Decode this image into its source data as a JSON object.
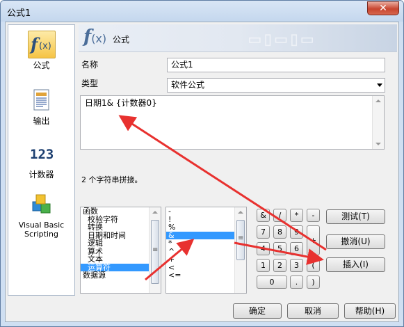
{
  "window": {
    "title": "公式1",
    "close_glyph": "✕"
  },
  "sidebar": {
    "items": [
      {
        "label": "公式",
        "icon": "formula-fx-icon"
      },
      {
        "label": "输出",
        "icon": "output-document-icon"
      },
      {
        "label": "计数器",
        "icon": "counter-123-icon"
      },
      {
        "label": "Visual Basic Scripting",
        "icon": "vbscript-cubes-icon"
      }
    ]
  },
  "header": {
    "title": "公式",
    "fx_glyph": "f",
    "fx_args": "(x)"
  },
  "form": {
    "name_label": "名称",
    "name_value": "公式1",
    "type_label": "类型",
    "type_value": "软件公式",
    "expression": "日期1& {计数器0}",
    "status": "2 个字符串拼接。"
  },
  "functions_list": [
    "函数",
    "校验字符",
    "转换",
    "日期和时间",
    "逻辑",
    "算术",
    "文本",
    "运算符",
    "数据源"
  ],
  "functions_selected": 7,
  "operators_list": [
    "-",
    "!",
    "%",
    "&",
    "*",
    "^",
    "+",
    "<",
    "<="
  ],
  "operators_selected": 3,
  "keypad": {
    "rows": [
      [
        "&",
        "/",
        "*",
        "-"
      ],
      [
        "7",
        "8",
        "9",
        "+"
      ],
      [
        "4",
        "5",
        "6"
      ],
      [
        "1",
        "2",
        "3",
        "("
      ],
      [
        "0",
        ".",
        ")"
      ]
    ]
  },
  "actions": {
    "test": "测试(T)",
    "undo": "撤消(U)",
    "insert": "插入(I)"
  },
  "footer": {
    "ok": "确定",
    "cancel": "取消",
    "help": "帮助(H)"
  },
  "colors": {
    "arrow": "#e8312f",
    "selection": "#3399ff",
    "title_bar": "#cfdff2"
  }
}
